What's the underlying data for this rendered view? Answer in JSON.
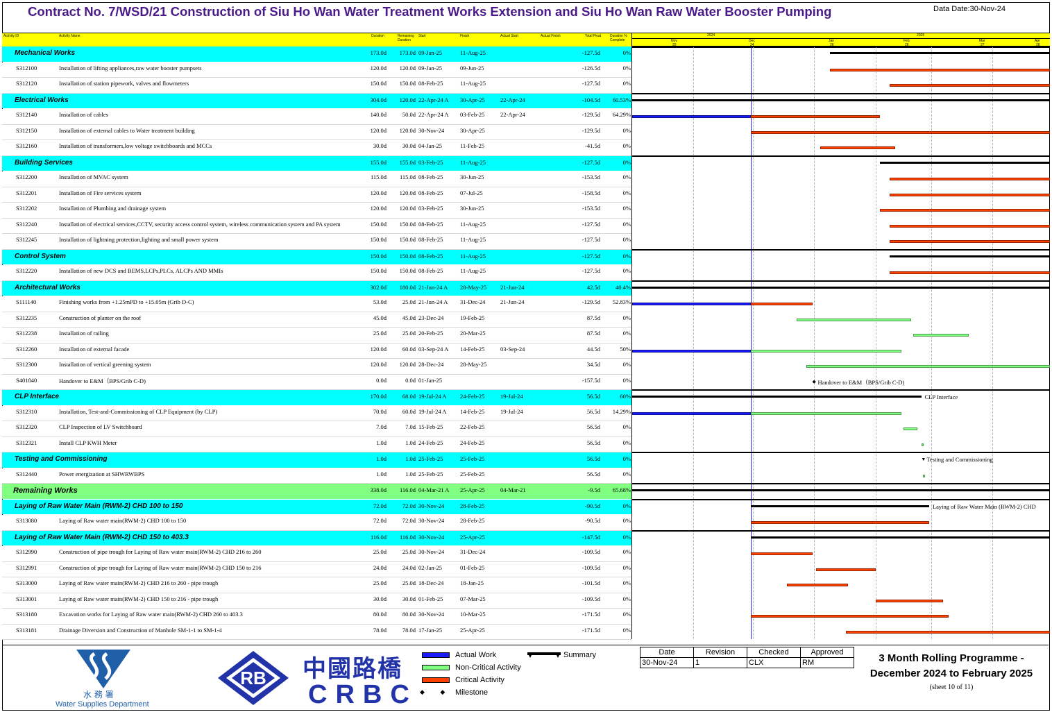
{
  "title": "Contract No. 7/WSD/21 Construction of Siu Ho Wan Water Treatment Works Extension and Siu Ho Wan Raw Water Booster Pumping",
  "data_date": "Data Date:30-Nov-24",
  "columns": [
    "Activity ID",
    "Activity Name",
    "Duration",
    "Remaining Duration",
    "Start",
    "Finish",
    "Actual Start",
    "Actual Finish",
    "Total Float",
    "Duration % Complete"
  ],
  "timescale": {
    "years": [
      "2024",
      "2025"
    ],
    "months": [
      "Nov",
      "Dec",
      "Jan",
      "Feb",
      "Mar",
      "Apr"
    ],
    "weeks": [
      "25",
      "24",
      "26",
      "26",
      "27",
      "28"
    ]
  },
  "rows": [
    {
      "type": "summary",
      "id": "",
      "name": "Mechanical Works",
      "dur": "173.0d",
      "rem": "173.0d",
      "start": "09-Jan-25",
      "finish": "11-Aug-25",
      "astart": "",
      "afinish": "",
      "tf": "-127.5d",
      "pct": "0%"
    },
    {
      "type": "task",
      "id": "S312100",
      "name": "Installation of lifting appliances,raw water booster pumpsets",
      "dur": "120.0d",
      "rem": "120.0d",
      "start": "09-Jan-25",
      "finish": "09-Jun-25",
      "astart": "",
      "afinish": "",
      "tf": "-126.5d",
      "pct": "0%"
    },
    {
      "type": "task",
      "id": "S312120",
      "name": "Installation of station pipework, valves and flowmeters",
      "dur": "150.0d",
      "rem": "150.0d",
      "start": "08-Feb-25",
      "finish": "11-Aug-25",
      "astart": "",
      "afinish": "",
      "tf": "-127.5d",
      "pct": "0%"
    },
    {
      "type": "summary",
      "id": "",
      "name": "Electrical Works",
      "dur": "304.0d",
      "rem": "120.0d",
      "start": "22-Apr-24 A",
      "finish": "30-Apr-25",
      "astart": "22-Apr-24",
      "afinish": "",
      "tf": "-104.5d",
      "pct": "60.53%"
    },
    {
      "type": "task",
      "id": "S312140",
      "name": "Installation of cables",
      "dur": "140.0d",
      "rem": "50.0d",
      "start": "22-Apr-24 A",
      "finish": "03-Feb-25",
      "astart": "22-Apr-24",
      "afinish": "",
      "tf": "-129.5d",
      "pct": "64.29%"
    },
    {
      "type": "task",
      "id": "S312150",
      "name": "Installation of external cables to Water treatment building",
      "dur": "120.0d",
      "rem": "120.0d",
      "start": "30-Nov-24",
      "finish": "30-Apr-25",
      "astart": "",
      "afinish": "",
      "tf": "-129.5d",
      "pct": "0%"
    },
    {
      "type": "task",
      "id": "S312160",
      "name": "Installation of transformers,low voltage switchboards and MCCs",
      "dur": "30.0d",
      "rem": "30.0d",
      "start": "04-Jan-25",
      "finish": "11-Feb-25",
      "astart": "",
      "afinish": "",
      "tf": "-41.5d",
      "pct": "0%"
    },
    {
      "type": "summary",
      "id": "",
      "name": "Building Services",
      "dur": "155.0d",
      "rem": "155.0d",
      "start": "03-Feb-25",
      "finish": "11-Aug-25",
      "astart": "",
      "afinish": "",
      "tf": "-127.5d",
      "pct": "0%"
    },
    {
      "type": "task",
      "id": "S312200",
      "name": "Installation of MVAC system",
      "dur": "115.0d",
      "rem": "115.0d",
      "start": "08-Feb-25",
      "finish": "30-Jun-25",
      "astart": "",
      "afinish": "",
      "tf": "-153.5d",
      "pct": "0%"
    },
    {
      "type": "task",
      "id": "S312201",
      "name": "Installation of Fire services system",
      "dur": "120.0d",
      "rem": "120.0d",
      "start": "08-Feb-25",
      "finish": "07-Jul-25",
      "astart": "",
      "afinish": "",
      "tf": "-158.5d",
      "pct": "0%"
    },
    {
      "type": "task",
      "id": "S312202",
      "name": "Installation of Plumbing and drainage system",
      "dur": "120.0d",
      "rem": "120.0d",
      "start": "03-Feb-25",
      "finish": "30-Jun-25",
      "astart": "",
      "afinish": "",
      "tf": "-153.5d",
      "pct": "0%"
    },
    {
      "type": "task",
      "id": "S312240",
      "name": "Installation of electrical services,CCTV, security access control system, wireless communication system and PA system",
      "dur": "150.0d",
      "rem": "150.0d",
      "start": "08-Feb-25",
      "finish": "11-Aug-25",
      "astart": "",
      "afinish": "",
      "tf": "-127.5d",
      "pct": "0%"
    },
    {
      "type": "task",
      "id": "S312245",
      "name": "Installation of lightning protection,lighting and small power system",
      "dur": "150.0d",
      "rem": "150.0d",
      "start": "08-Feb-25",
      "finish": "11-Aug-25",
      "astart": "",
      "afinish": "",
      "tf": "-127.5d",
      "pct": "0%"
    },
    {
      "type": "summary",
      "id": "",
      "name": "Control System",
      "dur": "150.0d",
      "rem": "150.0d",
      "start": "08-Feb-25",
      "finish": "11-Aug-25",
      "astart": "",
      "afinish": "",
      "tf": "-127.5d",
      "pct": "0%"
    },
    {
      "type": "task",
      "id": "S312220",
      "name": "Installation of new DCS and BEMS,LCPs,PLCs, ALCPs AND MMIs",
      "dur": "150.0d",
      "rem": "150.0d",
      "start": "08-Feb-25",
      "finish": "11-Aug-25",
      "astart": "",
      "afinish": "",
      "tf": "-127.5d",
      "pct": "0%"
    },
    {
      "type": "summary",
      "id": "",
      "name": "Architectural Works",
      "dur": "302.0d",
      "rem": "180.0d",
      "start": "21-Jun-24 A",
      "finish": "28-May-25",
      "astart": "21-Jun-24",
      "afinish": "",
      "tf": "42.5d",
      "pct": "40.4%"
    },
    {
      "type": "task",
      "id": "S111140",
      "name": "Finishing works from +1.25mPD to +15.05m (Grib D-C)",
      "dur": "53.0d",
      "rem": "25.0d",
      "start": "21-Jun-24 A",
      "finish": "31-Dec-24",
      "astart": "21-Jun-24",
      "afinish": "",
      "tf": "-129.5d",
      "pct": "52.83%"
    },
    {
      "type": "task",
      "id": "S312235",
      "name": "Construction of planter on the roof",
      "dur": "45.0d",
      "rem": "45.0d",
      "start": "23-Dec-24",
      "finish": "19-Feb-25",
      "astart": "",
      "afinish": "",
      "tf": "87.5d",
      "pct": "0%"
    },
    {
      "type": "task",
      "id": "S312238",
      "name": "Installation of railing",
      "dur": "25.0d",
      "rem": "25.0d",
      "start": "20-Feb-25",
      "finish": "20-Mar-25",
      "astart": "",
      "afinish": "",
      "tf": "87.5d",
      "pct": "0%"
    },
    {
      "type": "task",
      "id": "S312260",
      "name": "Installation of external facade",
      "dur": "120.0d",
      "rem": "60.0d",
      "start": "03-Sep-24 A",
      "finish": "14-Feb-25",
      "astart": "03-Sep-24",
      "afinish": "",
      "tf": "44.5d",
      "pct": "50%"
    },
    {
      "type": "task",
      "id": "S312300",
      "name": "Installation of vertical greening system",
      "dur": "120.0d",
      "rem": "120.0d",
      "start": "28-Dec-24",
      "finish": "28-May-25",
      "astart": "",
      "afinish": "",
      "tf": "34.5d",
      "pct": "0%"
    },
    {
      "type": "task",
      "id": "S401840",
      "name": "Handover to E&M（BPS/Grib C-D)",
      "dur": "0.0d",
      "rem": "0.0d",
      "start": "01-Jan-25",
      "finish": "",
      "astart": "",
      "afinish": "",
      "tf": "-157.5d",
      "pct": "0%"
    },
    {
      "type": "summary",
      "id": "",
      "name": "CLP Interface",
      "dur": "170.0d",
      "rem": "68.0d",
      "start": "19-Jul-24 A",
      "finish": "24-Feb-25",
      "astart": "19-Jul-24",
      "afinish": "",
      "tf": "56.5d",
      "pct": "60%"
    },
    {
      "type": "task",
      "id": "S312310",
      "name": "Installation, Test-and-Commissioning of CLP Equipment (by CLP)",
      "dur": "70.0d",
      "rem": "60.0d",
      "start": "19-Jul-24 A",
      "finish": "14-Feb-25",
      "astart": "19-Jul-24",
      "afinish": "",
      "tf": "56.5d",
      "pct": "14.29%"
    },
    {
      "type": "task",
      "id": "S312320",
      "name": "CLP Inspection of LV Switchboard",
      "dur": "7.0d",
      "rem": "7.0d",
      "start": "15-Feb-25",
      "finish": "22-Feb-25",
      "astart": "",
      "afinish": "",
      "tf": "56.5d",
      "pct": "0%"
    },
    {
      "type": "task",
      "id": "S312321",
      "name": "Install CLP KWH Meter",
      "dur": "1.0d",
      "rem": "1.0d",
      "start": "24-Feb-25",
      "finish": "24-Feb-25",
      "astart": "",
      "afinish": "",
      "tf": "56.5d",
      "pct": "0%"
    },
    {
      "type": "summary",
      "id": "",
      "name": "Testing and Commissioning",
      "dur": "1.0d",
      "rem": "1.0d",
      "start": "25-Feb-25",
      "finish": "25-Feb-25",
      "astart": "",
      "afinish": "",
      "tf": "56.5d",
      "pct": "0%"
    },
    {
      "type": "task",
      "id": "S312440",
      "name": "Power energization at SHWRWBPS",
      "dur": "1.0d",
      "rem": "1.0d",
      "start": "25-Feb-25",
      "finish": "25-Feb-25",
      "astart": "",
      "afinish": "",
      "tf": "56.5d",
      "pct": "0%"
    },
    {
      "type": "group",
      "id": "",
      "name": "Remaining Works",
      "dur": "338.0d",
      "rem": "116.0d",
      "start": "04-Mar-21 A",
      "finish": "25-Apr-25",
      "astart": "04-Mar-21",
      "afinish": "",
      "tf": "-9.5d",
      "pct": "65.68%"
    },
    {
      "type": "summary",
      "id": "",
      "name": "Laying of Raw Water Main (RWM-2) CHD 100  to 150",
      "dur": "72.0d",
      "rem": "72.0d",
      "start": "30-Nov-24",
      "finish": "28-Feb-25",
      "astart": "",
      "afinish": "",
      "tf": "-90.5d",
      "pct": "0%"
    },
    {
      "type": "task",
      "id": "S313080",
      "name": "Laying of Raw water main(RWM-2) CHD 100 to 150",
      "dur": "72.0d",
      "rem": "72.0d",
      "start": "30-Nov-24",
      "finish": "28-Feb-25",
      "astart": "",
      "afinish": "",
      "tf": "-90.5d",
      "pct": "0%"
    },
    {
      "type": "summary",
      "id": "",
      "name": "Laying of Raw Water Main (RWM-2) CHD 150  to 403.3",
      "dur": "116.0d",
      "rem": "116.0d",
      "start": "30-Nov-24",
      "finish": "25-Apr-25",
      "astart": "",
      "afinish": "",
      "tf": "-147.5d",
      "pct": "0%"
    },
    {
      "type": "task",
      "id": "S312990",
      "name": "Construction of pipe trough for Laying of Raw water main(RWM-2) CHD 216 to 260",
      "dur": "25.0d",
      "rem": "25.0d",
      "start": "30-Nov-24",
      "finish": "31-Dec-24",
      "astart": "",
      "afinish": "",
      "tf": "-109.5d",
      "pct": "0%"
    },
    {
      "type": "task",
      "id": "S312991",
      "name": "Construction of pipe trough for Laying of Raw water main(RWM-2) CHD 150 to 216",
      "dur": "24.0d",
      "rem": "24.0d",
      "start": "02-Jan-25",
      "finish": "01-Feb-25",
      "astart": "",
      "afinish": "",
      "tf": "-109.5d",
      "pct": "0%"
    },
    {
      "type": "task",
      "id": "S313000",
      "name": "Laying of Raw water main(RWM-2) CHD 216 to 260 - pipe trough",
      "dur": "25.0d",
      "rem": "25.0d",
      "start": "18-Dec-24",
      "finish": "18-Jan-25",
      "astart": "",
      "afinish": "",
      "tf": "-101.5d",
      "pct": "0%"
    },
    {
      "type": "task",
      "id": "S313001",
      "name": "Laying of Raw water main(RWM-2) CHD 150 to 216 - pipe trough",
      "dur": "30.0d",
      "rem": "30.0d",
      "start": "01-Feb-25",
      "finish": "07-Mar-25",
      "astart": "",
      "afinish": "",
      "tf": "-109.5d",
      "pct": "0%"
    },
    {
      "type": "task",
      "id": "S313180",
      "name": "Excavation works for Laying of Raw water main(RWM-2) CHD 260 to 403.3",
      "dur": "80.0d",
      "rem": "80.0d",
      "start": "30-Nov-24",
      "finish": "10-Mar-25",
      "astart": "",
      "afinish": "",
      "tf": "-171.5d",
      "pct": "0%"
    },
    {
      "type": "task",
      "id": "S313181",
      "name": "Drainage Diversion and Construction of Manhole SM-1-1 to SM-1-4",
      "dur": "78.0d",
      "rem": "78.0d",
      "start": "17-Jan-25",
      "finish": "25-Apr-25",
      "astart": "",
      "afinish": "",
      "tf": "-171.5d",
      "pct": "0%"
    }
  ],
  "chart_data": {
    "type": "gantt",
    "data_date": "30-Nov-24",
    "x_range": [
      "01-Oct-24",
      "30-Apr-25"
    ],
    "bars": [
      {
        "row": 0,
        "kind": "summary",
        "from": "09-Jan-25",
        "to": "30-Apr-25"
      },
      {
        "row": 1,
        "kind": "critical",
        "from": "09-Jan-25",
        "to": "30-Apr-25"
      },
      {
        "row": 2,
        "kind": "critical",
        "from": "08-Feb-25",
        "to": "30-Apr-25"
      },
      {
        "row": 3,
        "kind": "summary",
        "from": "01-Oct-24",
        "to": "30-Apr-25"
      },
      {
        "row": 4,
        "kind": "actual",
        "from": "01-Oct-24",
        "to": "30-Nov-24"
      },
      {
        "row": 4,
        "kind": "critical",
        "from": "30-Nov-24",
        "to": "03-Feb-25"
      },
      {
        "row": 5,
        "kind": "critical",
        "from": "30-Nov-24",
        "to": "30-Apr-25"
      },
      {
        "row": 6,
        "kind": "critical",
        "from": "04-Jan-25",
        "to": "11-Feb-25"
      },
      {
        "row": 7,
        "kind": "summary",
        "from": "03-Feb-25",
        "to": "30-Apr-25"
      },
      {
        "row": 8,
        "kind": "critical",
        "from": "08-Feb-25",
        "to": "30-Apr-25"
      },
      {
        "row": 9,
        "kind": "critical",
        "from": "08-Feb-25",
        "to": "30-Apr-25"
      },
      {
        "row": 10,
        "kind": "critical",
        "from": "03-Feb-25",
        "to": "30-Apr-25"
      },
      {
        "row": 11,
        "kind": "critical",
        "from": "08-Feb-25",
        "to": "30-Apr-25"
      },
      {
        "row": 12,
        "kind": "critical",
        "from": "08-Feb-25",
        "to": "30-Apr-25"
      },
      {
        "row": 13,
        "kind": "summary",
        "from": "08-Feb-25",
        "to": "30-Apr-25"
      },
      {
        "row": 14,
        "kind": "critical",
        "from": "08-Feb-25",
        "to": "30-Apr-25"
      },
      {
        "row": 15,
        "kind": "summary",
        "from": "01-Oct-24",
        "to": "30-Apr-25"
      },
      {
        "row": 16,
        "kind": "actual",
        "from": "01-Oct-24",
        "to": "30-Nov-24"
      },
      {
        "row": 16,
        "kind": "critical",
        "from": "30-Nov-24",
        "to": "31-Dec-24"
      },
      {
        "row": 17,
        "kind": "noncritical",
        "from": "23-Dec-24",
        "to": "19-Feb-25"
      },
      {
        "row": 18,
        "kind": "noncritical",
        "from": "20-Feb-25",
        "to": "20-Mar-25"
      },
      {
        "row": 19,
        "kind": "actual",
        "from": "01-Oct-24",
        "to": "30-Nov-24"
      },
      {
        "row": 19,
        "kind": "noncritical",
        "from": "30-Nov-24",
        "to": "14-Feb-25"
      },
      {
        "row": 20,
        "kind": "noncritical",
        "from": "28-Dec-24",
        "to": "30-Apr-25"
      },
      {
        "row": 21,
        "kind": "milestone",
        "from": "01-Jan-25",
        "to": "01-Jan-25",
        "label": "Handover to E&M（BPS/Grib C-D)"
      },
      {
        "row": 22,
        "kind": "summary",
        "from": "01-Oct-24",
        "to": "24-Feb-25",
        "label": "CLP Interface"
      },
      {
        "row": 23,
        "kind": "actual",
        "from": "01-Oct-24",
        "to": "30-Nov-24"
      },
      {
        "row": 23,
        "kind": "noncritical",
        "from": "30-Nov-24",
        "to": "14-Feb-25"
      },
      {
        "row": 24,
        "kind": "noncritical",
        "from": "15-Feb-25",
        "to": "22-Feb-25"
      },
      {
        "row": 25,
        "kind": "noncritical",
        "from": "24-Feb-25",
        "to": "24-Feb-25"
      },
      {
        "row": 26,
        "kind": "milestone",
        "from": "25-Feb-25",
        "to": "25-Feb-25",
        "label": "Testing and Commissioning"
      },
      {
        "row": 27,
        "kind": "noncritical",
        "from": "25-Feb-25",
        "to": "25-Feb-25"
      },
      {
        "row": 28,
        "kind": "summary",
        "from": "01-Oct-24",
        "to": "30-Apr-25"
      },
      {
        "row": 29,
        "kind": "summary",
        "from": "30-Nov-24",
        "to": "28-Feb-25",
        "label": "Laying of Raw Water Main (RWM-2) CHD"
      },
      {
        "row": 30,
        "kind": "critical",
        "from": "30-Nov-24",
        "to": "28-Feb-25"
      },
      {
        "row": 31,
        "kind": "summary",
        "from": "30-Nov-24",
        "to": "30-Apr-25"
      },
      {
        "row": 32,
        "kind": "critical",
        "from": "30-Nov-24",
        "to": "31-Dec-24"
      },
      {
        "row": 33,
        "kind": "critical",
        "from": "02-Jan-25",
        "to": "01-Feb-25"
      },
      {
        "row": 34,
        "kind": "critical",
        "from": "18-Dec-24",
        "to": "18-Jan-25"
      },
      {
        "row": 35,
        "kind": "critical",
        "from": "01-Feb-25",
        "to": "07-Mar-25"
      },
      {
        "row": 36,
        "kind": "critical",
        "from": "30-Nov-24",
        "to": "10-Mar-25"
      },
      {
        "row": 37,
        "kind": "critical",
        "from": "17-Jan-25",
        "to": "30-Apr-25"
      }
    ]
  },
  "legend": {
    "actual": "Actual Work",
    "noncritical": "Non-Critical Activity",
    "critical": "Critical Activity",
    "milestone": "Milestone",
    "summary": "Summary"
  },
  "colors": {
    "actual": "#1a1aff",
    "noncritical": "#80ff80",
    "critical": "#ff4000",
    "summary_row": "#00ffff",
    "group_row": "#80ff80",
    "header": "#ffff00",
    "title": "#4b1a8a"
  },
  "logos": {
    "wsd_cn": "水 務 署",
    "wsd_en": "Water Supplies Department",
    "crbc_cn": "中國路橋",
    "crbc_en": "CRBC",
    "rb": "RB"
  },
  "approval": {
    "headers": [
      "Date",
      "Revision",
      "Checked",
      "Approved"
    ],
    "values": [
      "30-Nov-24",
      "1",
      "CLX",
      "RM"
    ]
  },
  "programme_title_1": "3 Month Rolling Programme -",
  "programme_title_2": "December 2024 to February 2025",
  "sheet": "(sheet 10 of 11)"
}
